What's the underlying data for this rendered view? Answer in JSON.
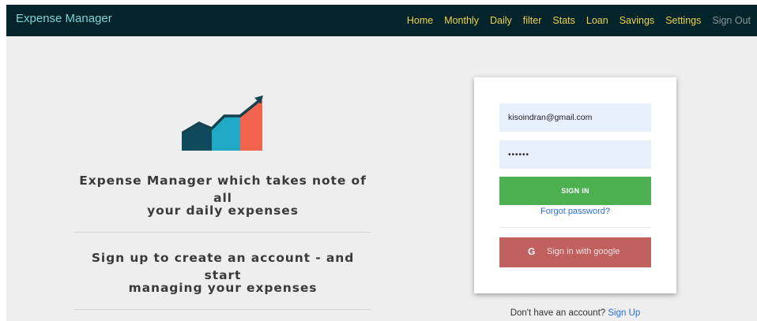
{
  "navbar": {
    "brand": "Expense Manager",
    "links": [
      "Home",
      "Monthly",
      "Daily",
      "filter",
      "Stats",
      "Loan",
      "Savings",
      "Settings"
    ],
    "signout": "Sign Out"
  },
  "hero": {
    "icon": "rising-chart-icon",
    "colors": {
      "navy": "#0e4a5c",
      "teal": "#22a9c6",
      "coral": "#f2644d",
      "arrow": "#16424f"
    },
    "tagline1_line1": "Expense Manager which takes note of all",
    "tagline1_line2": "your daily expenses",
    "tagline2_line1": "Sign up to create an account - and start",
    "tagline2_line2": "managing your expenses"
  },
  "login": {
    "email_value": "kisoindran@gmail.com",
    "password_value": "••••••",
    "signin_label": "SIGN IN",
    "forgot_label": "Forgot password?",
    "google_icon": "G",
    "google_label": "Sign in with google",
    "signup_prompt": "Don't have an account?",
    "signup_link": "Sign Up"
  },
  "colors": {
    "navbar_bg": "#03242b",
    "brand": "#7fd3d0",
    "nav_link": "#f1d24a",
    "signin": "#4caf50",
    "google": "#c06160",
    "link": "#2b6fd6"
  }
}
